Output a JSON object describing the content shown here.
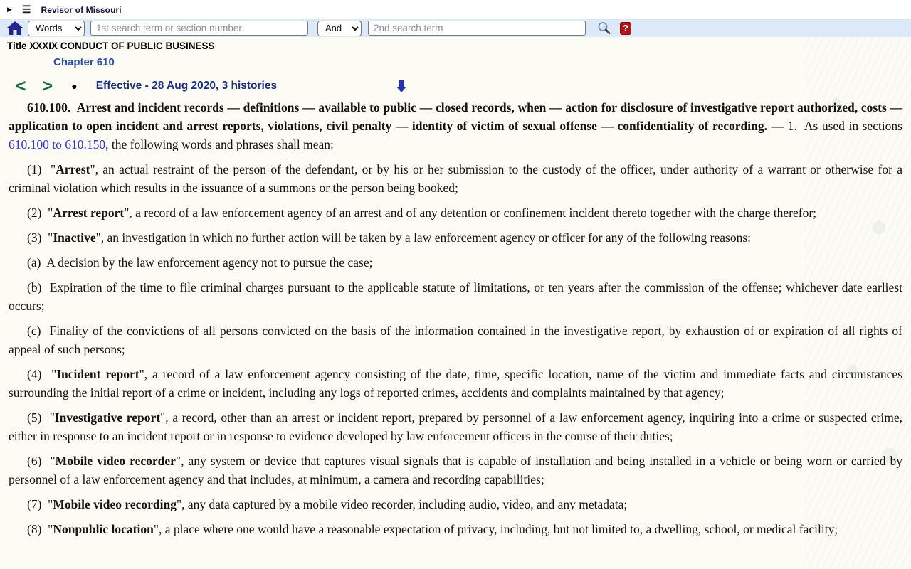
{
  "topbar": {
    "caret": "▶",
    "hamburger": "☰",
    "title": "Revisor of Missouri"
  },
  "search": {
    "mode": "Words",
    "placeholder1": "1st search term or section number",
    "operator": "And",
    "placeholder2": "2nd search term",
    "search_icon": "magnifier-glass",
    "home_icon": "house",
    "help": "?"
  },
  "breadcrumb": {
    "title": "Title XXXIX CONDUCT OF PUBLIC BUSINESS",
    "chapter": "Chapter 610"
  },
  "nav": {
    "prev": "<",
    "next": ">",
    "bullet": "●",
    "effective": "Effective - 28 Aug 2020, 3 histories",
    "down_arrow_icon": "down-arrow"
  },
  "colors": {
    "search_band": "#dce9f8",
    "navy": "#1b2f7d",
    "green": "#1c6b3d",
    "chapter_blue": "#2c4fad",
    "link_blue": "#3232cd",
    "help_red": "#b01818"
  },
  "statute": {
    "paragraphs": [
      {
        "segments": [
          {
            "text": "610.100.  Arrest and incident records — definitions — available to public — closed records, when — action for disclosure of investigative report authorized, costs — application to open incident and arrest reports, violations, civil penalty — identity of victim of sexual offense — confidentiality of recording. — ",
            "bold": true
          },
          {
            "text": "1.  As used in sections "
          },
          {
            "text": "610.100 to 610.150",
            "link": true
          },
          {
            "text": ", the following words and phrases shall mean:"
          }
        ]
      },
      {
        "segments": [
          {
            "text": "(1)  \""
          },
          {
            "text": "Arrest",
            "bold": true
          },
          {
            "text": "\", an actual restraint of the person of the defendant, or by his or her submission to the custody of the officer, under authority of a warrant or otherwise for a criminal violation which results in the issuance of a summons or the person being booked;"
          }
        ]
      },
      {
        "segments": [
          {
            "text": "(2)  \""
          },
          {
            "text": "Arrest report",
            "bold": true
          },
          {
            "text": "\", a record of a law enforcement agency of an arrest and of any detention or confinement incident thereto together with the charge therefor;"
          }
        ]
      },
      {
        "segments": [
          {
            "text": "(3)  \""
          },
          {
            "text": "Inactive",
            "bold": true
          },
          {
            "text": "\", an investigation in which no further action will be taken by a law enforcement agency or officer for any of the following reasons:"
          }
        ]
      },
      {
        "segments": [
          {
            "text": "(a)  A decision by the law enforcement agency not to pursue the case;"
          }
        ]
      },
      {
        "segments": [
          {
            "text": "(b)  Expiration of the time to file criminal charges pursuant to the applicable statute of limitations, or ten years after the commission of the offense; whichever date earliest occurs;"
          }
        ]
      },
      {
        "segments": [
          {
            "text": "(c)  Finality of the convictions of all persons convicted on the basis of the information contained in the investigative report, by exhaustion of or expiration of all rights of appeal of such persons;"
          }
        ]
      },
      {
        "segments": [
          {
            "text": "(4)  \""
          },
          {
            "text": "Incident report",
            "bold": true
          },
          {
            "text": "\", a record of a law enforcement agency consisting of the date, time, specific location, name of the victim and immediate facts and circumstances surrounding the initial report of a crime or incident, including any logs of reported crimes, accidents and complaints maintained by that agency;"
          }
        ]
      },
      {
        "segments": [
          {
            "text": "(5)  \""
          },
          {
            "text": "Investigative report",
            "bold": true
          },
          {
            "text": "\", a record, other than an arrest or incident report, prepared by personnel of a law enforcement agency, inquiring into a crime or suspected crime, either in response to an incident report or in response to evidence developed by law enforcement officers in the course of their duties;"
          }
        ]
      },
      {
        "segments": [
          {
            "text": "(6)  \""
          },
          {
            "text": "Mobile video recorder",
            "bold": true
          },
          {
            "text": "\", any system or device that captures visual signals that is capable of installation and being installed in a vehicle or being worn or carried by personnel of a law enforcement agency and that includes, at minimum, a camera and recording capabilities;"
          }
        ]
      },
      {
        "segments": [
          {
            "text": "(7)  \""
          },
          {
            "text": "Mobile video recording",
            "bold": true
          },
          {
            "text": "\", any data captured by a mobile video recorder, including audio, video, and any metadata;"
          }
        ]
      },
      {
        "segments": [
          {
            "text": "(8)  \""
          },
          {
            "text": "Nonpublic location",
            "bold": true
          },
          {
            "text": "\", a place where one would have a reasonable expectation of privacy, including, but not limited to, a dwelling, school, or medical facility;"
          }
        ]
      }
    ]
  }
}
